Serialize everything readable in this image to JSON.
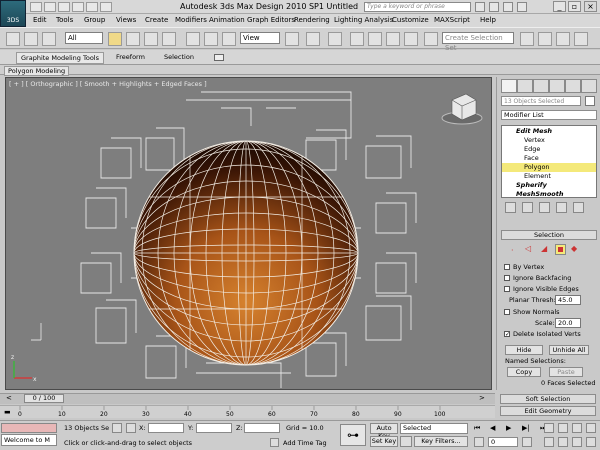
{
  "window": {
    "title": "Autodesk 3ds Max Design 2010 SP1     Untitled",
    "search_placeholder": "Type a keyword or phrase"
  },
  "app_button_label": "3DS",
  "menu": [
    "Edit",
    "Tools",
    "Group",
    "Views",
    "Create",
    "Modifiers",
    "Animation",
    "Graph Editors",
    "Rendering",
    "Lighting Analysis",
    "Customize",
    "MAXScript",
    "Help"
  ],
  "toolbar": {
    "selection_filter": "All",
    "reference_coord": "View",
    "named_selection_placeholder": "Create Selection Set"
  },
  "ribbon": {
    "tabs": [
      "Graphite Modeling Tools",
      "Freeform",
      "Selection"
    ],
    "active_panel": "Polygon Modeling"
  },
  "viewport": {
    "label": "[ + ] [ Orthographic ] [ Smooth + Highlights + Edged Faces ]"
  },
  "command_panel": {
    "object_name": "13 Objects Selected",
    "modifier_list": "Modifier List",
    "stack": [
      {
        "label": "Edit Mesh",
        "level": 0,
        "bold": true
      },
      {
        "label": "Vertex",
        "level": 1
      },
      {
        "label": "Edge",
        "level": 1
      },
      {
        "label": "Face",
        "level": 1
      },
      {
        "label": "Polygon",
        "level": 1,
        "selected": true
      },
      {
        "label": "Element",
        "level": 1
      },
      {
        "label": "Spherify",
        "level": 0,
        "bold": true
      },
      {
        "label": "MeshSmooth",
        "level": 0,
        "bold": true
      }
    ],
    "selection_rollout": {
      "title": "Selection",
      "by_vertex": "By Vertex",
      "ignore_backfacing": "Ignore Backfacing",
      "ignore_visible_edges": "Ignore Visible Edges",
      "planar_thresh_label": "Planar Thresh:",
      "planar_thresh_value": "45.0",
      "show_normals": "Show Normals",
      "scale_label": "Scale:",
      "scale_value": "20.0",
      "delete_isolated_verts": "Delete Isolated Verts",
      "hide_button": "Hide",
      "unhide_all_button": "Unhide All",
      "named_selections_label": "Named Selections:",
      "copy_button": "Copy",
      "paste_button": "Paste",
      "status": "0 Faces Selected"
    },
    "soft_selection_title": "Soft Selection",
    "edit_geometry_title": "Edit Geometry"
  },
  "timeline": {
    "frame_display": "0 / 100",
    "ticks": [
      "0",
      "10",
      "20",
      "30",
      "40",
      "50",
      "60",
      "70",
      "80",
      "90",
      "100"
    ]
  },
  "status": {
    "maxscript_listener": "Welcome to M",
    "selection_count": "13 Objects Se",
    "x_label": "X:",
    "y_label": "Y:",
    "z_label": "Z:",
    "grid": "Grid = 10.0",
    "prompt": "Click or click-and-drag to select objects",
    "add_time_tag": "Add Time Tag",
    "auto_key": "Auto Key",
    "set_key": "Set Key",
    "key_mode_selected": "Selected",
    "key_filters": "Key Filters...",
    "frame_value": "0"
  },
  "colors": {
    "sphere_wire": "#f3ede4",
    "selection_highlight": "#f4e97a",
    "viewport_bg": "#7e7e7e"
  }
}
